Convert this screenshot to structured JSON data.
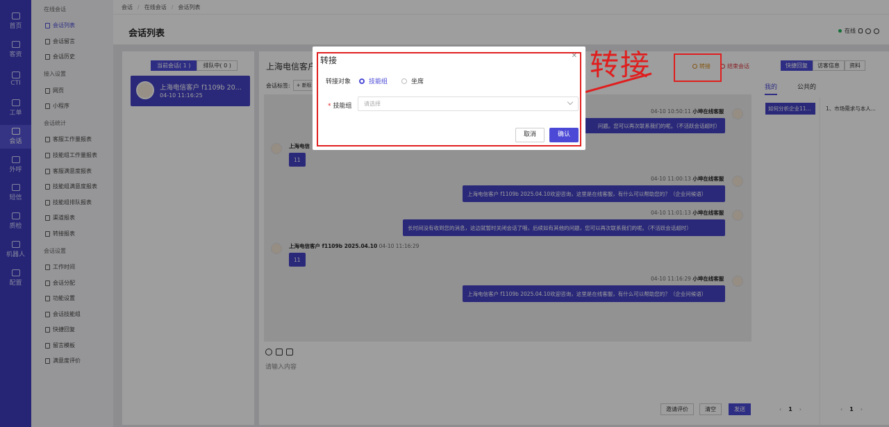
{
  "nav": [
    {
      "label": "首页",
      "icon": "home-icon",
      "active": false
    },
    {
      "label": "客资",
      "icon": "customer-icon",
      "active": false
    },
    {
      "label": "CTI",
      "icon": "cti-icon",
      "active": false
    },
    {
      "label": "工单",
      "icon": "ticket-icon",
      "active": false
    },
    {
      "label": "会话",
      "icon": "chat-icon",
      "active": true
    },
    {
      "label": "外呼",
      "icon": "phone-icon",
      "active": false
    },
    {
      "label": "短信",
      "icon": "sms-icon",
      "active": false
    },
    {
      "label": "质检",
      "icon": "inspect-icon",
      "active": false
    },
    {
      "label": "机器人",
      "icon": "robot-icon",
      "active": false
    },
    {
      "label": "配置",
      "icon": "settings-icon",
      "active": false
    }
  ],
  "sidebar": {
    "groups": [
      "在线会话",
      "接入设置",
      "会话统计",
      "会话设置"
    ],
    "items": [
      "会话列表",
      "会话留言",
      "会话历史",
      "网页",
      "小程序",
      "客服工作量报表",
      "技能组工作量报表",
      "客服满意度报表",
      "技能组满意度报表",
      "技能组排队报表",
      "渠道报表",
      "转接报表",
      "工作时间",
      "会话分配",
      "功能设置",
      "会话技能组",
      "快捷回复",
      "留言模板",
      "满意度评价"
    ]
  },
  "breadcrumb": [
    "会话",
    "在线会话",
    "会话列表"
  ],
  "page_title": "会话列表",
  "status": "在线",
  "left_panel": {
    "tab_current": "当前会话( 1 )",
    "tab_queue": "排队中( 0 )",
    "conversation": {
      "name": "上海电信客户 f1109b 20...",
      "time": "04-10 11:16:25"
    }
  },
  "mid_panel": {
    "title": "上海电信客户",
    "tag_label": "会话标签:",
    "new_tag": "+ 新标",
    "transfer": "转接",
    "end": "结束会话",
    "messages": {
      "m1_meta_time": "04-10 10:50:11",
      "m1_meta_name": "小坤在线客服",
      "m1_text": "问题。您可以再次联系我们的呢。（不活跃会话超时）",
      "m2_meta": "上海电信",
      "m2_text": "11",
      "m3_meta_time": "04-10 11:00:13",
      "m3_meta_name": "小坤在线客服",
      "m3_text": "上海电信客户 f1109b 2025.04.10欢迎咨询，这里是在线客服，有什么可以帮助您的？（企业问候语）",
      "m4_meta_time": "04-10 11:01:13",
      "m4_meta_name": "小坤在线客服",
      "m4_text": "长时间没有收到您的消息，这边就暂时关闭会话了哦，后续如有其他的问题，您可以再次联系我们的呢。（不活跃会话超时）",
      "m5_meta_name": "上海电信客户 f1109b 2025.04.10",
      "m5_meta_time": "04-10 11:16:29",
      "m5_text": "11",
      "m6_meta_time": "04-10 11:16:29",
      "m6_meta_name": "小坤在线客服",
      "m6_text": "上海电信客户 f1109b 2025.04.10欢迎咨询，这里是在线客服，有什么可以帮助您的？（企业问候语）"
    },
    "input_placeholder": "请输入内容",
    "btn_invite": "邀请评价",
    "btn_clear": "清空",
    "btn_send": "发送"
  },
  "right_panel": {
    "tabs": [
      "快捷回复",
      "访客信息",
      "资料"
    ],
    "sub_mine": "我的",
    "sub_public": "公共的",
    "chip_left": "如何分析企业11...",
    "chip_right": "1、市场需求与本人...",
    "page": "1"
  },
  "modal": {
    "title": "转接",
    "target_label": "转接对象",
    "option_group": "技能组",
    "option_seat": "坐席",
    "group_label": "技能组",
    "select_placeholder": "请选择",
    "cancel": "取消",
    "confirm": "确认"
  },
  "annotation": {
    "text": "转接",
    "color": "#e01e1e"
  },
  "colors": {
    "primary": "#4b49d6",
    "nav_bg": "#3d3bbd",
    "annotation": "#e01e1e"
  }
}
